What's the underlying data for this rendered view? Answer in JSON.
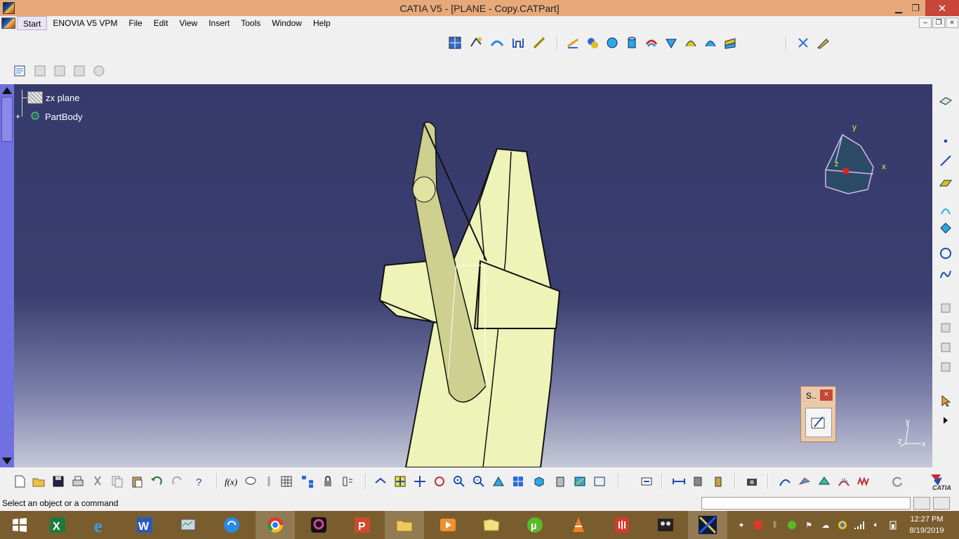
{
  "window": {
    "title": "CATIA V5 - [PLANE - Copy.CATPart]",
    "minimize": "▁",
    "maximize": "❐",
    "close": "✕"
  },
  "menu": {
    "items": [
      "Start",
      "ENOVIA V5 VPM",
      "File",
      "Edit",
      "View",
      "Insert",
      "Tools",
      "Window",
      "Help"
    ],
    "doc_controls": [
      "–",
      "❐",
      "×"
    ]
  },
  "tree": {
    "nodes": [
      {
        "label": "zx plane",
        "icon": "plane-icon"
      },
      {
        "label": "PartBody",
        "icon": "gear-body-icon"
      }
    ]
  },
  "compass": {
    "x": "x",
    "y": "y",
    "z": "z"
  },
  "axis_triad": {
    "x": "x",
    "y": "y",
    "z": "z"
  },
  "sketch_panel": {
    "title": "S..",
    "close": "×"
  },
  "status": {
    "message": "Select an object or a command",
    "command_value": ""
  },
  "clock": {
    "time": "12:27 PM",
    "date": "8/19/2019"
  },
  "colors": {
    "title_bar": "#e8a97a",
    "viewport_top": "#363a6b",
    "viewport_bottom": "#c7c9d8",
    "part_fill": "#eaf0b0",
    "tree_scroll": "#7070e0",
    "taskbar": "#7a5d2e",
    "close_red": "#c7463a"
  },
  "taskbar_apps": [
    "excel-icon",
    "ie-icon",
    "word-icon",
    "task-manager-icon",
    "sync-icon",
    "chrome-icon",
    "picsart-icon",
    "powerpoint-icon",
    "file-explorer-icon",
    "video-player-icon",
    "folder-icon",
    "utorrent-icon",
    "vlc-icon",
    "pdf-icon",
    "media-icon",
    "catia-icon"
  ]
}
